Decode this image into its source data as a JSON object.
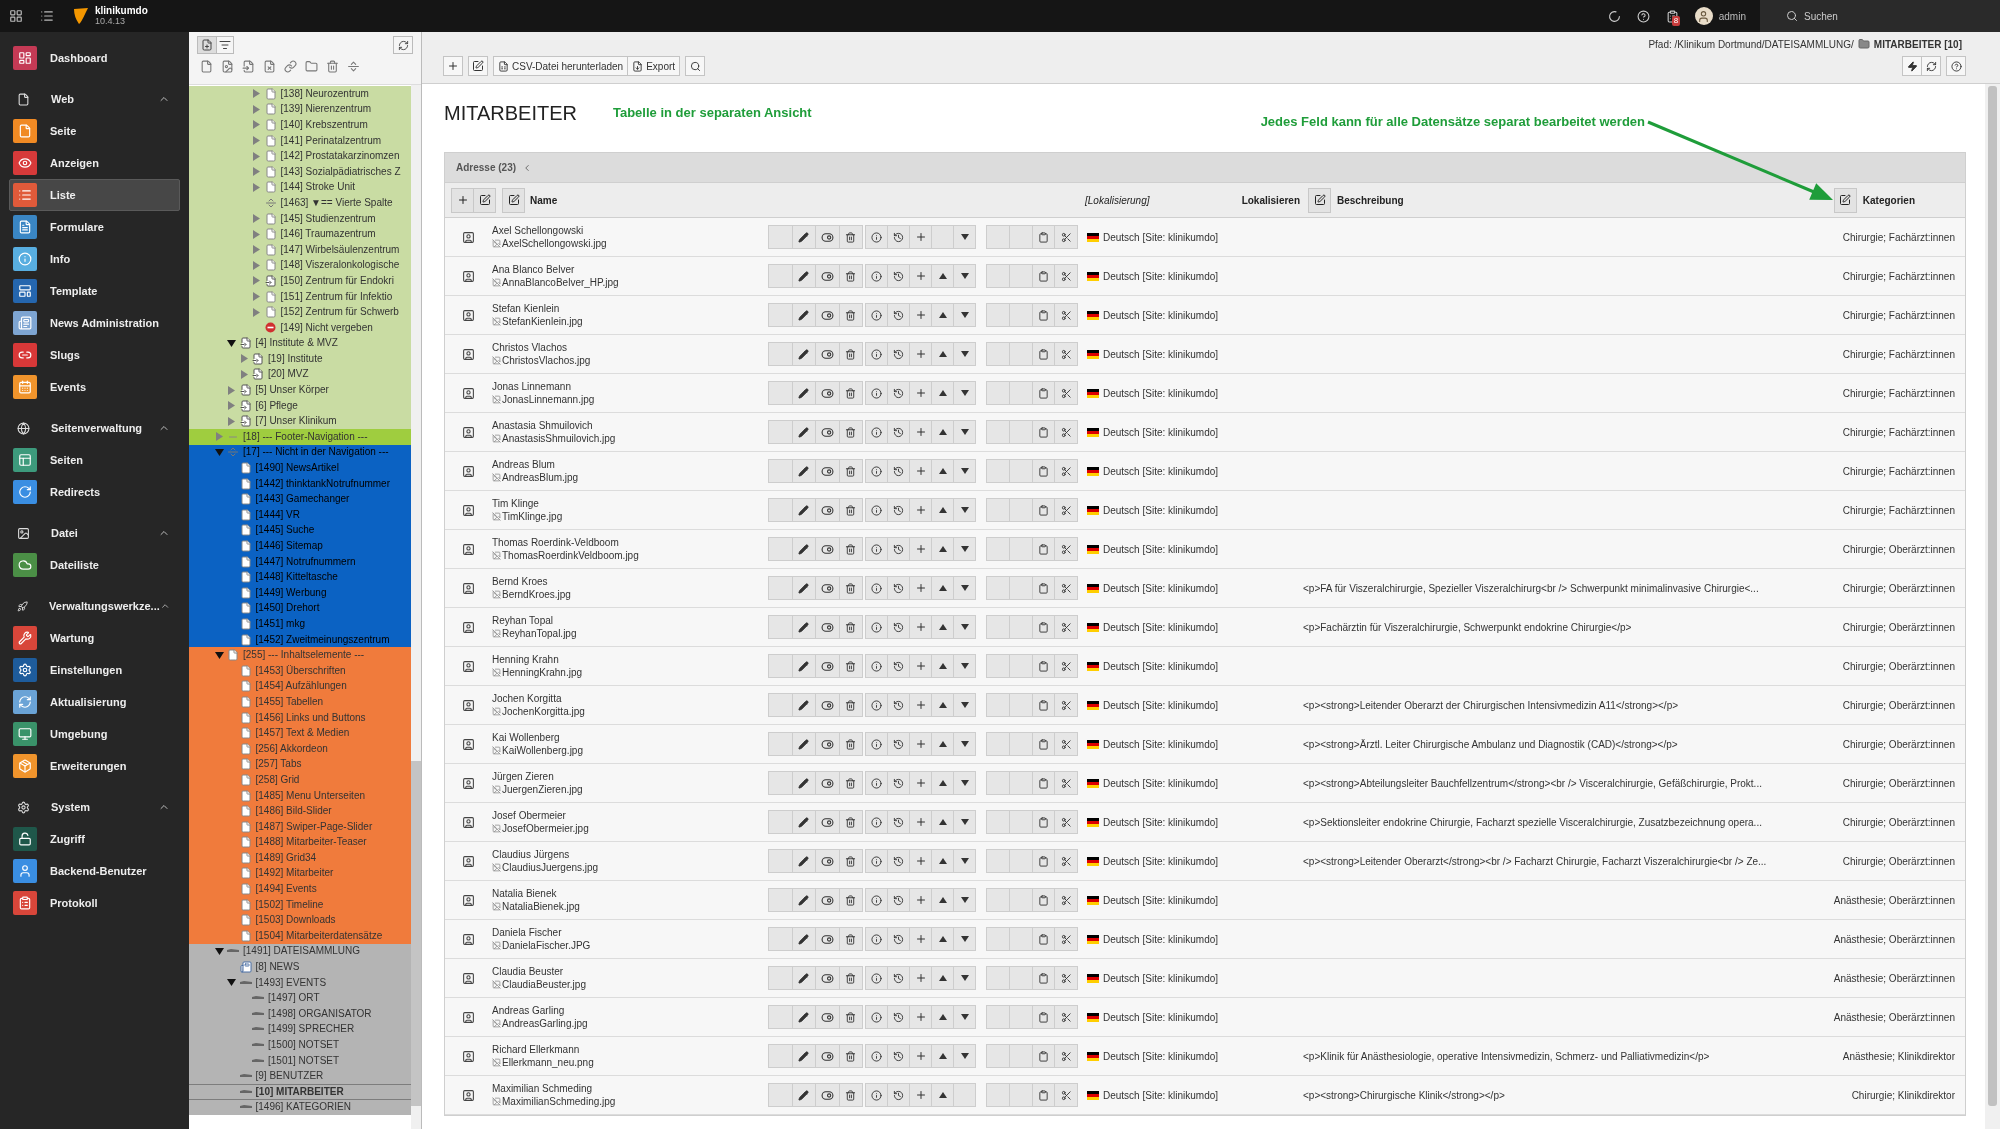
{
  "topbar": {
    "site_name": "klinikumdo",
    "version": "10.4.13",
    "notification_count": "8",
    "user": "admin",
    "search_label": "Suchen"
  },
  "modules": [
    {
      "kind": "module",
      "label": "Dashboard",
      "color": "#c43a55",
      "selected": false
    },
    {
      "kind": "section",
      "label": "Web",
      "expanded": true
    },
    {
      "kind": "module",
      "label": "Seite",
      "color": "#f08a24",
      "selected": false
    },
    {
      "kind": "module",
      "label": "Anzeigen",
      "color": "#d73a3a",
      "selected": false
    },
    {
      "kind": "module",
      "label": "Liste",
      "color": "#e05a3a",
      "selected": true
    },
    {
      "kind": "module",
      "label": "Formulare",
      "color": "#3a86c4",
      "selected": false
    },
    {
      "kind": "module",
      "label": "Info",
      "color": "#58aee0",
      "selected": false
    },
    {
      "kind": "module",
      "label": "Template",
      "color": "#2566ae",
      "selected": false
    },
    {
      "kind": "module",
      "label": "News Administration",
      "color": "#7ea5d2",
      "selected": false
    },
    {
      "kind": "module",
      "label": "Slugs",
      "color": "#d83838",
      "selected": false
    },
    {
      "kind": "module",
      "label": "Events",
      "color": "#f0942c",
      "selected": false
    },
    {
      "kind": "section",
      "label": "Seitenverwaltung",
      "expanded": true
    },
    {
      "kind": "module",
      "label": "Seiten",
      "color": "#3d9a7c",
      "selected": false
    },
    {
      "kind": "module",
      "label": "Redirects",
      "color": "#3a8ee2",
      "selected": false
    },
    {
      "kind": "section",
      "label": "Datei",
      "expanded": true
    },
    {
      "kind": "module",
      "label": "Dateiliste",
      "color": "#4b8f46",
      "selected": false
    },
    {
      "kind": "section",
      "label": "Verwaltungswerkze...",
      "expanded": true
    },
    {
      "kind": "module",
      "label": "Wartung",
      "color": "#d8463a",
      "selected": false
    },
    {
      "kind": "module",
      "label": "Einstellungen",
      "color": "#1e5c9c",
      "selected": false
    },
    {
      "kind": "module",
      "label": "Aktualisierung",
      "color": "#6aa3d6",
      "selected": false
    },
    {
      "kind": "module",
      "label": "Umgebung",
      "color": "#3a936a",
      "selected": false
    },
    {
      "kind": "module",
      "label": "Erweiterungen",
      "color": "#f0942c",
      "selected": false
    },
    {
      "kind": "section",
      "label": "System",
      "expanded": true
    },
    {
      "kind": "module",
      "label": "Zugriff",
      "color": "#1f574a",
      "selected": false
    },
    {
      "kind": "module",
      "label": "Backend-Benutzer",
      "color": "#3a8ee2",
      "selected": false
    },
    {
      "kind": "module",
      "label": "Protokoll",
      "color": "#d8463a",
      "selected": false
    }
  ],
  "page_tree": {
    "upper_branch": [
      {
        "label": "[138] Neurozentrum",
        "kind": "page",
        "expanded": false,
        "color": "#c9dca3"
      },
      {
        "label": "[139] Nierenzentrum",
        "kind": "page",
        "expanded": false,
        "color": "#c9dca3"
      },
      {
        "label": "[140] Krebszentrum",
        "kind": "page",
        "expanded": false,
        "color": "#c9dca3"
      },
      {
        "label": "[141] Perinatalzentrum",
        "kind": "page",
        "expanded": false,
        "color": "#c9dca3"
      },
      {
        "label": "[142] Prostatakarzinomzen",
        "kind": "page",
        "expanded": false,
        "color": "#c9dca3"
      },
      {
        "label": "[143] Sozialpädiatrisches Z",
        "kind": "page",
        "expanded": false,
        "color": "#c9dca3"
      },
      {
        "label": "[144] Stroke Unit",
        "kind": "page",
        "expanded": false,
        "color": "#c9dca3"
      },
      {
        "label": "[1463] ▼== Vierte Spalte",
        "kind": "separator",
        "color": "#c9dca3"
      },
      {
        "label": "[145] Studienzentrum",
        "kind": "page",
        "expanded": false,
        "color": "#c9dca3"
      },
      {
        "label": "[146] Traumazentrum",
        "kind": "page",
        "expanded": false,
        "color": "#c9dca3"
      },
      {
        "label": "[147] Wirbelsäulenzentrum",
        "kind": "page",
        "expanded": false,
        "color": "#c9dca3"
      },
      {
        "label": "[148] Viszeralonkologische",
        "kind": "page",
        "expanded": false,
        "color": "#c9dca3"
      },
      {
        "label": "[150] Zentrum für Endokri",
        "kind": "shortcut",
        "expanded": false,
        "color": "#c9dca3"
      },
      {
        "label": "[151] Zentrum für Infektio",
        "kind": "page",
        "expanded": false,
        "color": "#c9dca3"
      },
      {
        "label": "[152] Zentrum für Schwerb",
        "kind": "page",
        "expanded": false,
        "color": "#c9dca3"
      },
      {
        "label": "[149] Nicht vergeben",
        "kind": "restricted",
        "color": "#c9dca3"
      }
    ],
    "branch": [
      {
        "label": "[4] Institute & MVZ",
        "kind": "shortcut",
        "expanded": true,
        "color": "#c9dca3",
        "children": [
          {
            "label": "[19] Institute",
            "kind": "shortcut",
            "expanded": false,
            "color": "#c9dca3"
          },
          {
            "label": "[20] MVZ",
            "kind": "shortcut",
            "expanded": false,
            "color": "#c9dca3"
          }
        ]
      },
      {
        "label": "[5] Unser Körper",
        "kind": "shortcut",
        "expanded": false,
        "color": "#c9dca3"
      },
      {
        "label": "[6] Pflege",
        "kind": "shortcut",
        "expanded": false,
        "color": "#c9dca3"
      },
      {
        "label": "[7] Unser Klinikum",
        "kind": "shortcut",
        "expanded": false,
        "color": "#c9dca3"
      }
    ],
    "items": [
      {
        "label": "[18] --- Footer-Navigation ---",
        "kind": "spacer",
        "expanded": false,
        "color": "#9fcd3f"
      },
      {
        "label": "[17] --- Nicht in der Navigation ---",
        "kind": "separator",
        "expanded": true,
        "color": "#0b62c3",
        "children": [
          {
            "label": "[1490] NewsArtikel",
            "kind": "page",
            "color": "#0b62c3"
          },
          {
            "label": "[1442] thinktankNotrufnummer",
            "kind": "page",
            "color": "#0b62c3"
          },
          {
            "label": "[1443] Gamechanger",
            "kind": "page",
            "color": "#0b62c3"
          },
          {
            "label": "[1444] VR",
            "kind": "page",
            "color": "#0b62c3"
          },
          {
            "label": "[1445] Suche",
            "kind": "page",
            "color": "#0b62c3"
          },
          {
            "label": "[1446] Sitemap",
            "kind": "page",
            "color": "#0b62c3"
          },
          {
            "label": "[1447] Notrufnummern",
            "kind": "page",
            "color": "#0b62c3"
          },
          {
            "label": "[1448] Kitteltasche",
            "kind": "page",
            "color": "#0b62c3"
          },
          {
            "label": "[1449] Werbung",
            "kind": "page",
            "color": "#0b62c3"
          },
          {
            "label": "[1450] Drehort",
            "kind": "page",
            "color": "#0b62c3"
          },
          {
            "label": "[1451] mkg",
            "kind": "page",
            "color": "#0b62c3"
          },
          {
            "label": "[1452] Zweitmeinungszentrum",
            "kind": "page",
            "color": "#0b62c3"
          }
        ]
      },
      {
        "label": "[255] --- Inhaltselemente ---",
        "kind": "page",
        "expanded": true,
        "color": "#f07b3c",
        "children": [
          {
            "label": "[1453] Überschriften",
            "kind": "page",
            "color": "#f07b3c"
          },
          {
            "label": "[1454] Aufzählungen",
            "kind": "page",
            "color": "#f07b3c"
          },
          {
            "label": "[1455] Tabellen",
            "kind": "page",
            "color": "#f07b3c"
          },
          {
            "label": "[1456] Links und Buttons",
            "kind": "page",
            "color": "#f07b3c"
          },
          {
            "label": "[1457] Text & Medien",
            "kind": "page",
            "color": "#f07b3c"
          },
          {
            "label": "[256] Akkordeon",
            "kind": "page",
            "color": "#f07b3c"
          },
          {
            "label": "[257] Tabs",
            "kind": "page",
            "color": "#f07b3c"
          },
          {
            "label": "[258] Grid",
            "kind": "page",
            "color": "#f07b3c"
          },
          {
            "label": "[1485] Menu Unterseiten",
            "kind": "page",
            "color": "#f07b3c"
          },
          {
            "label": "[1486] Bild-Slider",
            "kind": "page",
            "color": "#f07b3c"
          },
          {
            "label": "[1487] Swiper-Page-Slider",
            "kind": "page",
            "color": "#f07b3c"
          },
          {
            "label": "[1488] Mitarbeiter-Teaser",
            "kind": "page",
            "color": "#f07b3c"
          },
          {
            "label": "[1489] Grid34",
            "kind": "page",
            "color": "#f07b3c"
          },
          {
            "label": "[1492] Mitarbeiter",
            "kind": "page",
            "color": "#f07b3c"
          },
          {
            "label": "[1494] Events",
            "kind": "page",
            "color": "#f07b3c"
          },
          {
            "label": "[1502] Timeline",
            "kind": "page",
            "color": "#f07b3c"
          },
          {
            "label": "[1503] Downloads",
            "kind": "page",
            "color": "#f07b3c"
          },
          {
            "label": "[1504] Mitarbeiterdatensätze",
            "kind": "page",
            "color": "#f07b3c"
          }
        ]
      },
      {
        "label": "[1491] DATEISAMMLUNG",
        "kind": "folder",
        "expanded": true,
        "color": "#b4b4b4",
        "children": [
          {
            "label": "[8] NEWS",
            "kind": "news_folder",
            "color": "#b4b4b4",
            "selected": false
          },
          {
            "label": "[1493] EVENTS",
            "kind": "folder",
            "expanded": true,
            "color": "#b4b4b4",
            "selected": false,
            "children": [
              {
                "label": "[1497] ORT",
                "kind": "folder",
                "color": "#b4b4b4"
              },
              {
                "label": "[1498] ORGANISATOR",
                "kind": "folder",
                "color": "#b4b4b4"
              },
              {
                "label": "[1499] SPRECHER",
                "kind": "folder",
                "color": "#b4b4b4"
              },
              {
                "label": "[1500] NOTSET",
                "kind": "folder",
                "color": "#b4b4b4"
              },
              {
                "label": "[1501] NOTSET",
                "kind": "folder",
                "color": "#b4b4b4"
              }
            ]
          },
          {
            "label": "[9] BENUTZER",
            "kind": "folder",
            "color": "#b4b4b4",
            "selected": false
          },
          {
            "label": "[10] MITARBEITER",
            "kind": "folder",
            "color": "#b4b4b4",
            "selected": true
          },
          {
            "label": "[1496] KATEGORIEN",
            "kind": "folder",
            "color": "#b4b4b4",
            "selected": false
          }
        ]
      }
    ]
  },
  "docheader": {
    "path_prefix": "Pfad: /Klinikum Dortmund/DATEISAMMLUNG/",
    "path_current": "MITARBEITER [10]",
    "csv_label": "CSV-Datei herunterladen",
    "export_label": "Export"
  },
  "title": "MITARBEITER",
  "annotations": [
    "Tabelle in der separaten Ansicht",
    "Jedes Feld kann für alle Datensätze separat bearbeitet werden"
  ],
  "table": {
    "title": "Adresse (23)",
    "columns": [
      "Name",
      "[Lokalisierung]",
      "Lokalisieren",
      "Beschreibung",
      "Kategorien"
    ],
    "rows": [
      {
        "name": "Axel Schellongowski",
        "image": "AxelSchellongowski.jpg",
        "localization": "Deutsch [Site: klinikumdo]",
        "categories": "Chirurgie; Fachärzt:innen",
        "can_move_up": false,
        "can_move_down": true
      },
      {
        "name": "Ana Blanco Belver",
        "image": "AnnaBlancoBelver_HP.jpg",
        "localization": "Deutsch [Site: klinikumdo]",
        "categories": "Chirurgie; Fachärzt:innen",
        "can_move_up": true,
        "can_move_down": true
      },
      {
        "name": "Stefan Kienlein",
        "image": "StefanKienlein.jpg",
        "localization": "Deutsch [Site: klinikumdo]",
        "categories": "Chirurgie; Fachärzt:innen",
        "can_move_up": true,
        "can_move_down": true
      },
      {
        "name": "Christos Vlachos",
        "image": "ChristosVlachos.jpg",
        "localization": "Deutsch [Site: klinikumdo]",
        "categories": "Chirurgie; Fachärzt:innen",
        "can_move_up": true,
        "can_move_down": true
      },
      {
        "name": "Jonas Linnemann",
        "image": "JonasLinnemann.jpg",
        "localization": "Deutsch [Site: klinikumdo]",
        "categories": "Chirurgie; Fachärzt:innen",
        "can_move_up": true,
        "can_move_down": true
      },
      {
        "name": "Anastasia Shmuilovich",
        "image": "AnastasisShmuilovich.jpg",
        "localization": "Deutsch [Site: klinikumdo]",
        "categories": "Chirurgie; Fachärzt:innen",
        "can_move_up": true,
        "can_move_down": true
      },
      {
        "name": "Andreas Blum",
        "image": "AndreasBlum.jpg",
        "localization": "Deutsch [Site: klinikumdo]",
        "categories": "Chirurgie; Fachärzt:innen",
        "can_move_up": true,
        "can_move_down": true
      },
      {
        "name": "Tim Klinge",
        "image": "TimKlinge.jpg",
        "localization": "Deutsch [Site: klinikumdo]",
        "categories": "Chirurgie; Fachärzt:innen",
        "can_move_up": true,
        "can_move_down": true
      },
      {
        "name": "Thomas Roerdink-Veldboom",
        "image": "ThomasRoerdinkVeldboom.jpg",
        "localization": "Deutsch [Site: klinikumdo]",
        "categories": "Chirurgie; Oberärzt:innen",
        "can_move_up": true,
        "can_move_down": true
      },
      {
        "name": "Bernd Kroes",
        "image": "BerndKroes.jpg",
        "localization": "Deutsch [Site: klinikumdo]",
        "description": "<p>FA für Viszeralchirurgie, Spezieller Viszeralchirurg<br /> Schwerpunkt minimalinvasive Chirurgie<...",
        "categories": "Chirurgie; Oberärzt:innen",
        "can_move_up": true,
        "can_move_down": true
      },
      {
        "name": "Reyhan Topal",
        "image": "ReyhanTopal.jpg",
        "localization": "Deutsch [Site: klinikumdo]",
        "description": "<p>Fachärztin für Viszeralchirurgie, Schwerpunkt endokrine Chirurgie</p>",
        "categories": "Chirurgie; Oberärzt:innen",
        "can_move_up": true,
        "can_move_down": true
      },
      {
        "name": "Henning Krahn",
        "image": "HenningKrahn.jpg",
        "localization": "Deutsch [Site: klinikumdo]",
        "categories": "Chirurgie; Oberärzt:innen",
        "can_move_up": true,
        "can_move_down": true
      },
      {
        "name": "Jochen Korgitta",
        "image": "JochenKorgitta.jpg",
        "localization": "Deutsch [Site: klinikumdo]",
        "description": "<p><strong>Leitender Oberarzt der Chirurgischen Intensivmedizin A11</strong></p>",
        "categories": "Chirurgie; Oberärzt:innen",
        "can_move_up": true,
        "can_move_down": true
      },
      {
        "name": "Kai Wollenberg",
        "image": "KaiWollenberg.jpg",
        "localization": "Deutsch [Site: klinikumdo]",
        "description": "<p><strong>Ärztl. Leiter Chirurgische Ambulanz und Diagnostik (CAD)</strong></p>",
        "categories": "Chirurgie; Oberärzt:innen",
        "can_move_up": true,
        "can_move_down": true
      },
      {
        "name": "Jürgen Zieren",
        "image": "JuergenZieren.jpg",
        "localization": "Deutsch [Site: klinikumdo]",
        "description": "<p><strong>Abteilungsleiter Bauchfellzentrum</strong><br /> Visceralchirurgie, Gefäßchirurgie, Prokt...",
        "categories": "Chirurgie; Oberärzt:innen",
        "can_move_up": true,
        "can_move_down": true
      },
      {
        "name": "Josef Obermeier",
        "image": "JosefObermeier.jpg",
        "localization": "Deutsch [Site: klinikumdo]",
        "description": "<p>Sektionsleiter endokrine Chirurgie, Facharzt spezielle Visceralchirurgie, Zusatzbezeichnung opera...",
        "categories": "Chirurgie; Oberärzt:innen",
        "can_move_up": true,
        "can_move_down": true
      },
      {
        "name": "Claudius Jürgens",
        "image": "ClaudiusJuergens.jpg",
        "localization": "Deutsch [Site: klinikumdo]",
        "description": "<p><strong>Leitender Oberarzt</strong><br /> Facharzt Chirurgie, Facharzt Viszeralchirurgie<br /> Ze...",
        "categories": "Chirurgie; Oberärzt:innen",
        "can_move_up": true,
        "can_move_down": true
      },
      {
        "name": "Natalia Bienek",
        "image": "NataliaBienek.jpg",
        "localization": "Deutsch [Site: klinikumdo]",
        "categories": "Anästhesie; Oberärzt:innen",
        "can_move_up": true,
        "can_move_down": true
      },
      {
        "name": "Daniela Fischer",
        "image": "DanielaFischer.JPG",
        "localization": "Deutsch [Site: klinikumdo]",
        "categories": "Anästhesie; Oberärzt:innen",
        "can_move_up": true,
        "can_move_down": true
      },
      {
        "name": "Claudia Beuster",
        "image": "ClaudiaBeuster.jpg",
        "localization": "Deutsch [Site: klinikumdo]",
        "categories": "Anästhesie; Oberärzt:innen",
        "can_move_up": true,
        "can_move_down": true
      },
      {
        "name": "Andreas Garling",
        "image": "AndreasGarling.jpg",
        "localization": "Deutsch [Site: klinikumdo]",
        "categories": "Anästhesie; Oberärzt:innen",
        "can_move_up": true,
        "can_move_down": true
      },
      {
        "name": "Richard Ellerkmann",
        "image": "Ellerkmann_neu.png",
        "localization": "Deutsch [Site: klinikumdo]",
        "description": "<p>Klinik für Anästhesiologie, operative Intensivmedizin, Schmerz- und Palliativmedizin</p>",
        "categories": "Anästhesie; Klinikdirektor",
        "can_move_up": true,
        "can_move_down": true
      },
      {
        "name": "Maximilian Schmeding",
        "image": "MaximilianSchmeding.jpg",
        "localization": "Deutsch [Site: klinikumdo]",
        "description": "<p><strong>Chirurgische Klinik</strong></p>",
        "categories": "Chirurgie; Klinikdirektor",
        "can_move_up": true,
        "can_move_down": false
      }
    ]
  }
}
